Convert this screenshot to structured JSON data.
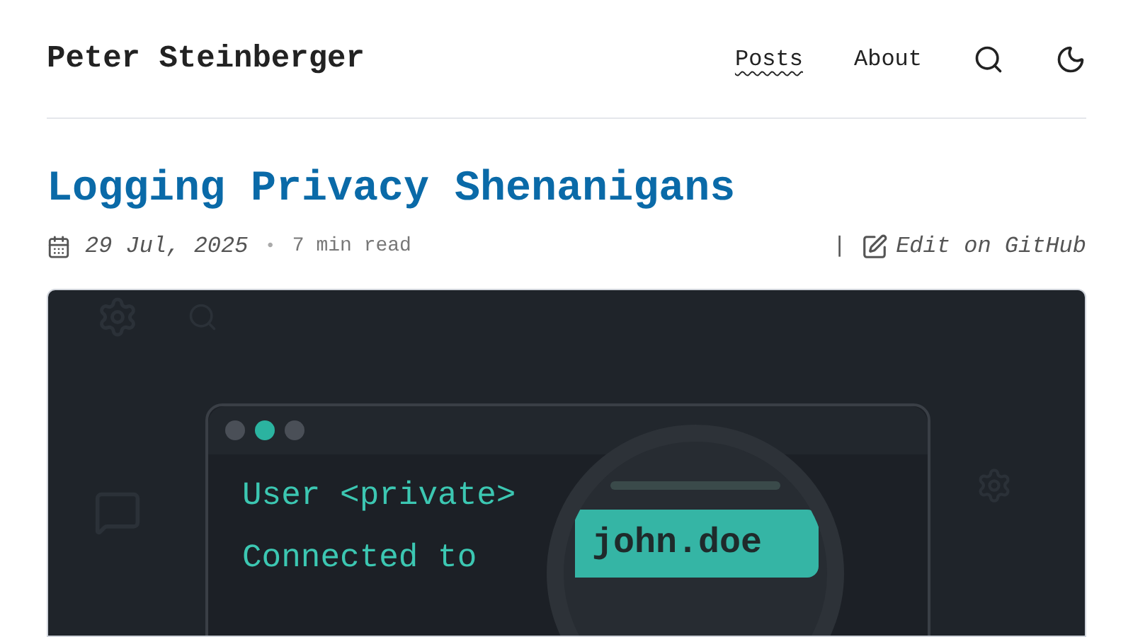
{
  "site_title": "Peter Steinberger",
  "nav": [
    {
      "label": "Posts",
      "selected": true
    },
    {
      "label": "About",
      "selected": false
    }
  ],
  "post": {
    "title": "Logging Privacy Shenanigans",
    "date": "29 Jul, 2025",
    "separator": "•",
    "read_time": "7 min read",
    "divider": "|",
    "edit_link": "Edit on GitHub"
  },
  "hero": {
    "log_lines": [
      {
        "kind": "plain",
        "text": "User <private>"
      },
      {
        "kind": "plain",
        "text": "Connected to"
      }
    ],
    "magnified_text": "john.doe"
  }
}
